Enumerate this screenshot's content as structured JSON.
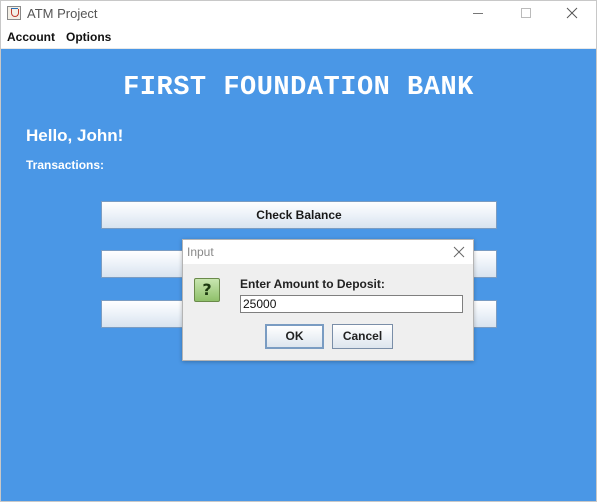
{
  "window": {
    "title": "ATM Project",
    "controls": {
      "minimize": "minimize",
      "maximize": "maximize",
      "close": "close"
    }
  },
  "menu": {
    "items": [
      "Account",
      "Options"
    ]
  },
  "main": {
    "bank_name": "FIRST FOUNDATION BANK",
    "greeting": "Hello, John!",
    "transactions_label": "Transactions:",
    "buttons": [
      "Check Balance",
      "",
      ""
    ],
    "background_color": "#4a97e6"
  },
  "dialog": {
    "title": "Input",
    "icon": "question-icon",
    "prompt": "Enter Amount to Deposit:",
    "input_value": "25000",
    "ok_label": "OK",
    "cancel_label": "Cancel"
  }
}
